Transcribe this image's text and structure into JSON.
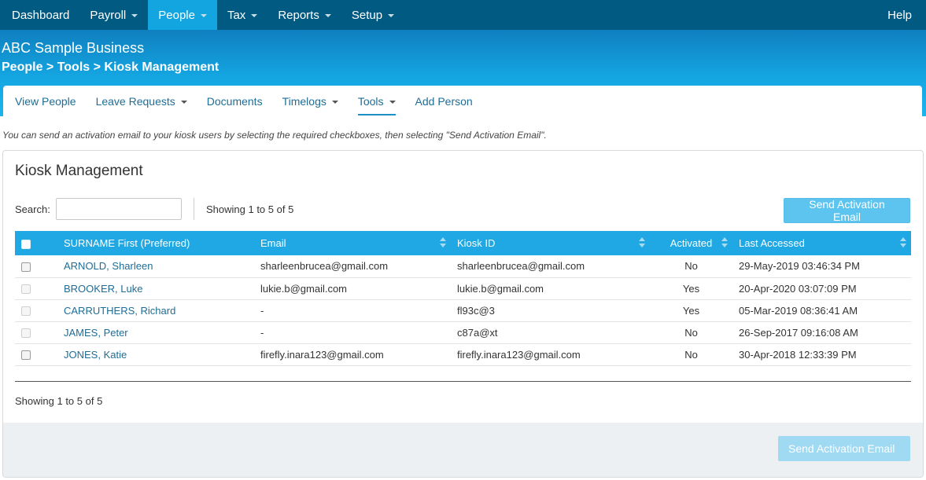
{
  "topnav": {
    "items": [
      {
        "label": "Dashboard",
        "caret": false,
        "active": false
      },
      {
        "label": "Payroll",
        "caret": true,
        "active": false
      },
      {
        "label": "People",
        "caret": true,
        "active": true
      },
      {
        "label": "Tax",
        "caret": true,
        "active": false
      },
      {
        "label": "Reports",
        "caret": true,
        "active": false
      },
      {
        "label": "Setup",
        "caret": true,
        "active": false
      }
    ],
    "help": "Help"
  },
  "header": {
    "business": "ABC Sample Business",
    "breadcrumb": "People > Tools > Kiosk Management"
  },
  "subnav": {
    "items": [
      {
        "label": "View People",
        "caret": false,
        "active": false
      },
      {
        "label": "Leave Requests",
        "caret": true,
        "active": false
      },
      {
        "label": "Documents",
        "caret": false,
        "active": false
      },
      {
        "label": "Timelogs",
        "caret": true,
        "active": false
      },
      {
        "label": "Tools",
        "caret": true,
        "active": true
      },
      {
        "label": "Add Person",
        "caret": false,
        "active": false
      }
    ]
  },
  "hint": "You can send an activation email to your kiosk users by selecting the required checkboxes, then selecting \"Send Activation Email\".",
  "panel": {
    "title": "Kiosk Management",
    "search_label": "Search:",
    "search_value": "",
    "showing": "Showing 1 to 5 of 5",
    "send_button": "Send Activation Email"
  },
  "table": {
    "columns": [
      "SURNAME First (Preferred)",
      "Email",
      "Kiosk ID",
      "Activated",
      "Last Accessed"
    ],
    "rows": [
      {
        "name": "ARNOLD, Sharleen",
        "email": "sharleenbrucea@gmail.com",
        "kiosk_id": "sharleenbrucea@gmail.com",
        "activated": "No",
        "last_accessed": "29-May-2019 03:46:34 PM",
        "selectable": true
      },
      {
        "name": "BROOKER, Luke",
        "email": "lukie.b@gmail.com",
        "kiosk_id": "lukie.b@gmail.com",
        "activated": "Yes",
        "last_accessed": "20-Apr-2020 03:07:09 PM",
        "selectable": false
      },
      {
        "name": "CARRUTHERS, Richard",
        "email": "-",
        "kiosk_id": "fl93c@3",
        "activated": "Yes",
        "last_accessed": "05-Mar-2019 08:36:41 AM",
        "selectable": false
      },
      {
        "name": "JAMES, Peter",
        "email": "-",
        "kiosk_id": "c87a@xt",
        "activated": "No",
        "last_accessed": "26-Sep-2017 09:16:08 AM",
        "selectable": false
      },
      {
        "name": "JONES, Katie",
        "email": "firefly.inara123@gmail.com",
        "kiosk_id": "firefly.inara123@gmail.com",
        "activated": "No",
        "last_accessed": "30-Apr-2018 12:33:39 PM",
        "selectable": true
      }
    ]
  },
  "colors": {
    "topnav": "#005a82",
    "accent": "#1fa8e3",
    "link": "#1e6d96"
  }
}
